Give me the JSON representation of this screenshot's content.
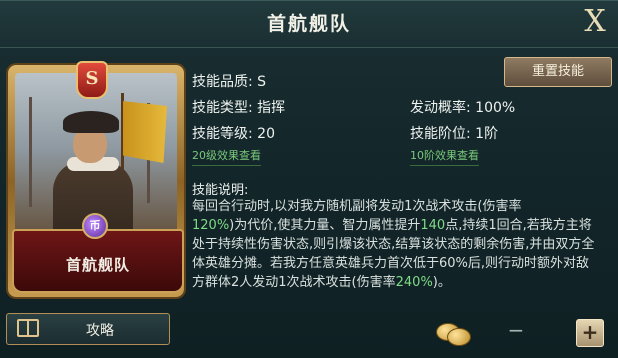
{
  "header": {
    "title": "首航舰队",
    "close_label": "X"
  },
  "card": {
    "rank": "S",
    "gem_label": "币",
    "name": "首航舰队"
  },
  "strategy": {
    "label": "攻略"
  },
  "reset": {
    "label": "重置技能"
  },
  "info": {
    "quality_label": "技能品质:",
    "quality_value": "S",
    "type_label": "技能类型:",
    "type_value": "指挥",
    "rate_label": "发动概率:",
    "rate_value": "100%",
    "level_label": "技能等级:",
    "level_value": "20",
    "tier_label": "技能阶位:",
    "tier_value": "1阶",
    "level_link": "20级效果查看",
    "tier_link": "10阶效果查看"
  },
  "description": {
    "title": "技能说明:",
    "p1": "每回合行动时,以对我方随机副将发动1次战术攻击(伤害率",
    "p2_hl": "120%",
    "p2": ")为代价,使其力量、智力属性提升",
    "p2_hl2": "140",
    "p2_b": "点,持续1回合,若我方主将处于持续性伤害状态,则引爆该状态,结算该状态的剩余伤害,并由双方全体英雄分摊。若我方任意英雄兵力首次低于60%后,则行动时额外对敌方群体2人发动1次战术攻击(伤害率",
    "p3_hl": "240%",
    "p3": ")。"
  },
  "footer": {
    "minus": "−",
    "plus": "+"
  }
}
